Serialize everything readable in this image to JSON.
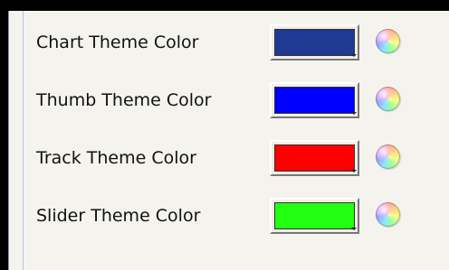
{
  "theme_colors": [
    {
      "label": "Chart Theme Color",
      "color": "#1f3a93",
      "picker_icon": "color-wheel-icon"
    },
    {
      "label": "Thumb Theme Color",
      "color": "#0000ff",
      "picker_icon": "color-wheel-icon"
    },
    {
      "label": "Track Theme Color",
      "color": "#ff0000",
      "picker_icon": "color-wheel-icon"
    },
    {
      "label": "Slider Theme Color",
      "color": "#22ff11",
      "picker_icon": "color-wheel-icon"
    }
  ]
}
